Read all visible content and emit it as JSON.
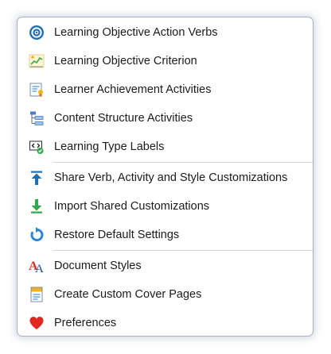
{
  "menu": {
    "items": [
      {
        "label": "Learning Objective Action Verbs",
        "icon": "target-icon"
      },
      {
        "label": "Learning Objective Criterion",
        "icon": "line-chart-icon"
      },
      {
        "label": "Learner Achievement Activities",
        "icon": "certificate-icon"
      },
      {
        "label": "Content Structure Activities",
        "icon": "tree-structure-icon"
      },
      {
        "label": "Learning Type Labels",
        "icon": "code-tag-check-icon"
      },
      {
        "label": "Share Verb, Activity and Style Customizations",
        "icon": "upload-arrow-icon"
      },
      {
        "label": "Import Shared Customizations",
        "icon": "download-arrow-icon"
      },
      {
        "label": "Restore Default Settings",
        "icon": "restore-icon"
      },
      {
        "label": "Document Styles",
        "icon": "text-styles-icon"
      },
      {
        "label": "Create Custom Cover Pages",
        "icon": "cover-page-icon"
      },
      {
        "label": "Preferences",
        "icon": "heart-icon"
      }
    ]
  },
  "colors": {
    "target": "#1f6fb2",
    "upload": "#1f6fb2",
    "download": "#2eaa4a",
    "restore": "#2f86d6",
    "heart": "#e0281e",
    "check": "#2eaa4a"
  }
}
